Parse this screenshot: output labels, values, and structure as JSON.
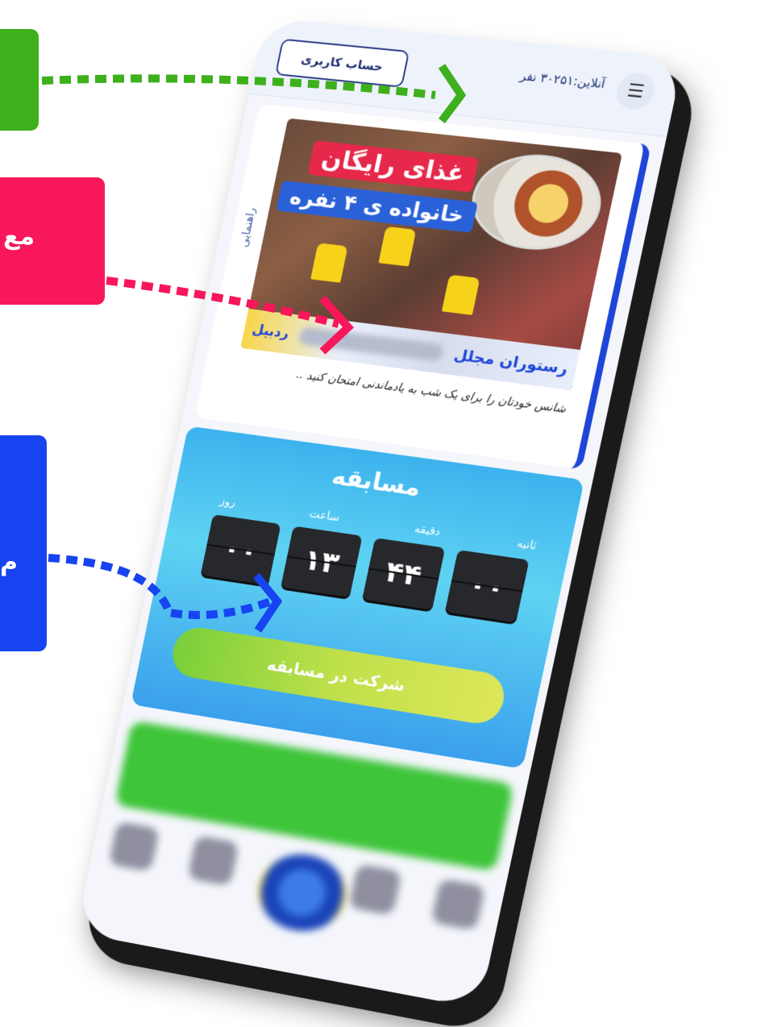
{
  "callouts": {
    "pink_text": "مع",
    "blue_text": "م"
  },
  "header": {
    "online_text": "آنلاین:۳۰۲۵۱ نفر",
    "account_button": "حساب کاربری",
    "menu_icon": "hamburger-icon"
  },
  "ad": {
    "guide_label": "راهنمایی",
    "banner_line1": "غذای رایگان",
    "banner_line2": "خانواده ی ۴ نفره",
    "footer_right": "رستوران مجلل",
    "footer_left": "ردبیل",
    "caption": "شانس خودتان را برای یک شب به یادماندنی امتحان کنید .."
  },
  "contest": {
    "title": "مسابقه",
    "labels": {
      "day": "روز",
      "hour": "ساعت",
      "minute": "دقیقه",
      "second": "ثانیه"
    },
    "digits": {
      "day": "۰۰",
      "hour": "۱۳",
      "minute": "۴۴",
      "second": "۰۰"
    },
    "join_button": "شرکت در مسابقه"
  },
  "colors": {
    "green_callout": "#3db01c",
    "pink_callout": "#f7175a",
    "blue_callout": "#1744f0",
    "accent_blue": "#1d46d8"
  }
}
